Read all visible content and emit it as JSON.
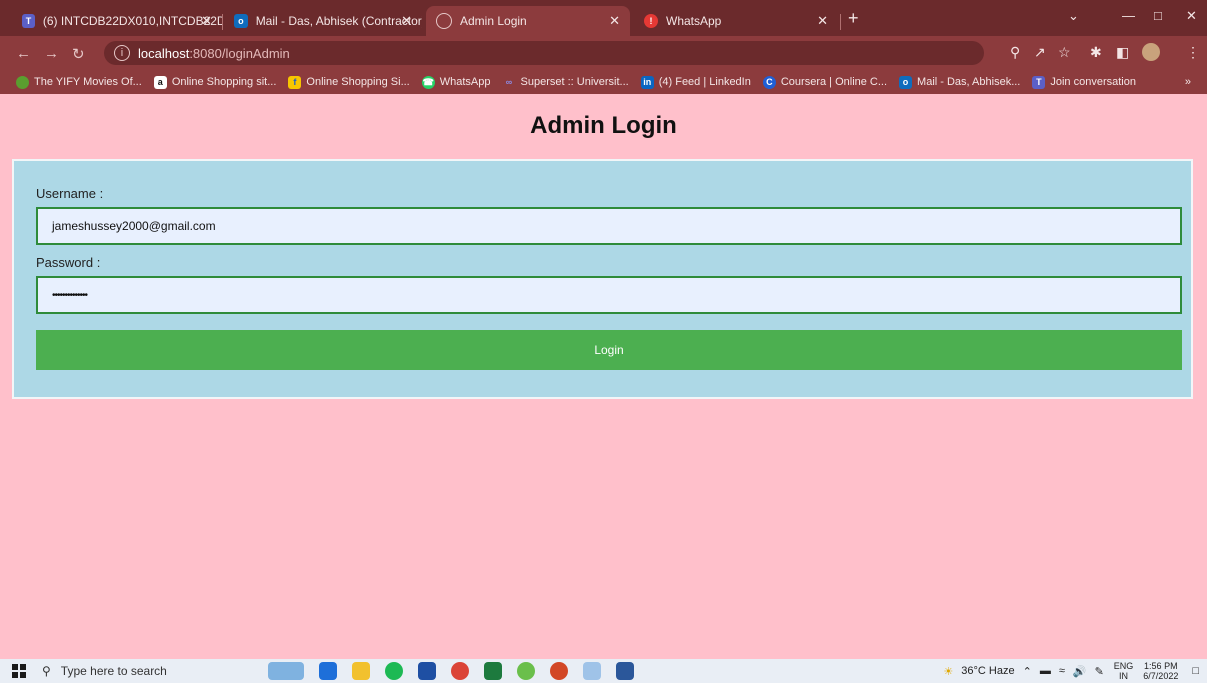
{
  "browser": {
    "tabs": [
      {
        "title": "(6) INTCDB22DX010,INTCDB22D…",
        "icon": "teams-icon",
        "color": "#5b5fc7"
      },
      {
        "title": "Mail - Das, Abhisek (Contractor)",
        "icon": "outlook-icon",
        "color": "#0f6cbd"
      },
      {
        "title": "Admin Login",
        "icon": "globe-icon",
        "color": "#8c3b3d"
      },
      {
        "title": "WhatsApp",
        "icon": "whatsapp-icon",
        "color": "#e53935"
      }
    ],
    "tab_close": "✕",
    "new_tab": "+",
    "url_host": "localhost",
    "url_path": ":8080/loginAdmin",
    "bookmarks": [
      {
        "label": "The YIFY Movies Of...",
        "icon": "yify-icon",
        "color": "#5a9e2f",
        "glyph": ""
      },
      {
        "label": "Online Shopping sit...",
        "icon": "amazon-icon",
        "color": "#111111",
        "glyph": "a"
      },
      {
        "label": "Online Shopping Si...",
        "icon": "flipkart-icon",
        "color": "#f7c600",
        "glyph": "f"
      },
      {
        "label": "WhatsApp",
        "icon": "whatsapp-icon",
        "color": "#25d366",
        "glyph": "☎"
      },
      {
        "label": "Superset :: Universit...",
        "icon": "superset-icon",
        "color": "#6a6ad0",
        "glyph": "∞"
      },
      {
        "label": "(4) Feed | LinkedIn",
        "icon": "linkedin-icon",
        "color": "#0a66c2",
        "glyph": "in"
      },
      {
        "label": "Coursera | Online C...",
        "icon": "coursera-icon",
        "color": "#1f5fd6",
        "glyph": "C"
      },
      {
        "label": "Mail - Das, Abhisek...",
        "icon": "outlook-icon",
        "color": "#0f6cbd",
        "glyph": "o"
      },
      {
        "label": "Join conversation",
        "icon": "teams-icon",
        "color": "#5b5fc7",
        "glyph": "T"
      }
    ]
  },
  "page": {
    "title": "Admin Login",
    "username_label": "Username :",
    "username_value": "jameshussey2000@gmail.com",
    "password_label": "Password :",
    "password_value": "••••••••••••••",
    "login_button": "Login"
  },
  "taskbar": {
    "search_placeholder": "Type here to search",
    "weather": "36°C Haze",
    "language": "ENG",
    "region": "IN",
    "time": "1:56 PM",
    "date": "6/7/2022"
  },
  "colors": {
    "page_bg": "#ffc0cb",
    "panel_bg": "#add8e6",
    "field_border": "#2e8b3a",
    "login_button": "#4caf50",
    "browser_frame": "#8c3b3d"
  }
}
